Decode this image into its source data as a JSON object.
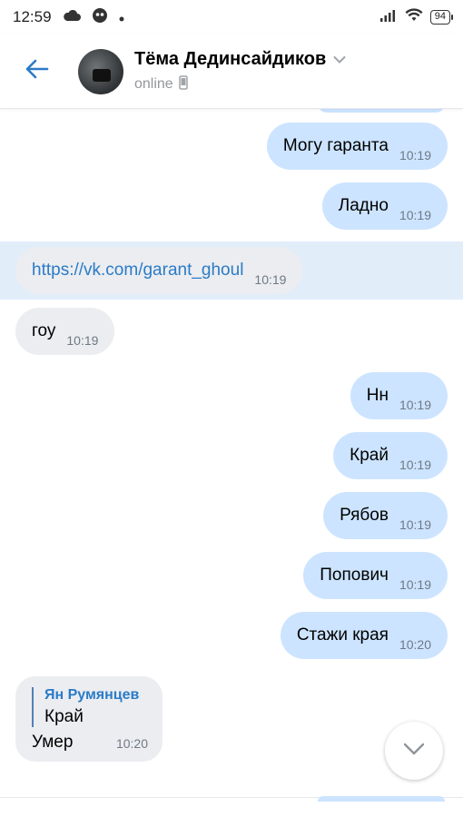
{
  "status_bar": {
    "time": "12:59",
    "battery": "94"
  },
  "header": {
    "name": "Тёма Дединсайдиков",
    "status": "online"
  },
  "messages": [
    {
      "dir": "out",
      "text": "Могу гаранта",
      "time": "10:19"
    },
    {
      "dir": "out",
      "text": "Ладно",
      "time": "10:19"
    },
    {
      "dir": "in",
      "text": "https://vk.com/garant_ghoul",
      "time": "10:19",
      "link": true,
      "highlighted": true
    },
    {
      "dir": "in",
      "text": "гоу",
      "time": "10:19"
    },
    {
      "dir": "out",
      "text": "Нн",
      "time": "10:19"
    },
    {
      "dir": "out",
      "text": "Край",
      "time": "10:19"
    },
    {
      "dir": "out",
      "text": "Рябов",
      "time": "10:19"
    },
    {
      "dir": "out",
      "text": "Попович",
      "time": "10:19"
    },
    {
      "dir": "out",
      "text": "Стажи края",
      "time": "10:20"
    }
  ],
  "reply_message": {
    "quote_author": "Ян Румянцев",
    "quote_text": "Край",
    "text": "Умер",
    "time": "10:20"
  },
  "icons": {
    "back": "arrow-left-icon",
    "dropdown": "chevron-down-icon",
    "device": "mobile-phone-icon",
    "scroll": "chevron-down-icon"
  },
  "colors": {
    "accent": "#2b7bc7",
    "outgoing_bubble": "#cce4ff",
    "incoming_bubble": "#ebedf0",
    "highlight": "#e2edfa"
  }
}
